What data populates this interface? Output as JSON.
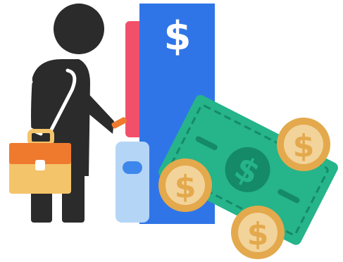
{
  "illustration": {
    "machine_symbol": "$",
    "coin_symbol": "$",
    "bill_symbol": "$"
  },
  "colors": {
    "figure": "#2b2b2b",
    "machine_blue": "#2f75e8",
    "machine_red": "#f2506a",
    "dispenser_light_blue": "#b5d5f6",
    "dispenser_slot_blue": "#3d87ec",
    "briefcase_orange": "#ef7a2e",
    "briefcase_yellow": "#f4c46a",
    "bill_green": "#26b48a",
    "bill_dark_green": "#158a68",
    "coin_yellow": "#f2d39a",
    "coin_rim": "#e3a94c"
  },
  "icons": [
    "person-icon",
    "briefcase-icon",
    "atm-icon",
    "dollar-bill-icon",
    "coin-icon"
  ]
}
